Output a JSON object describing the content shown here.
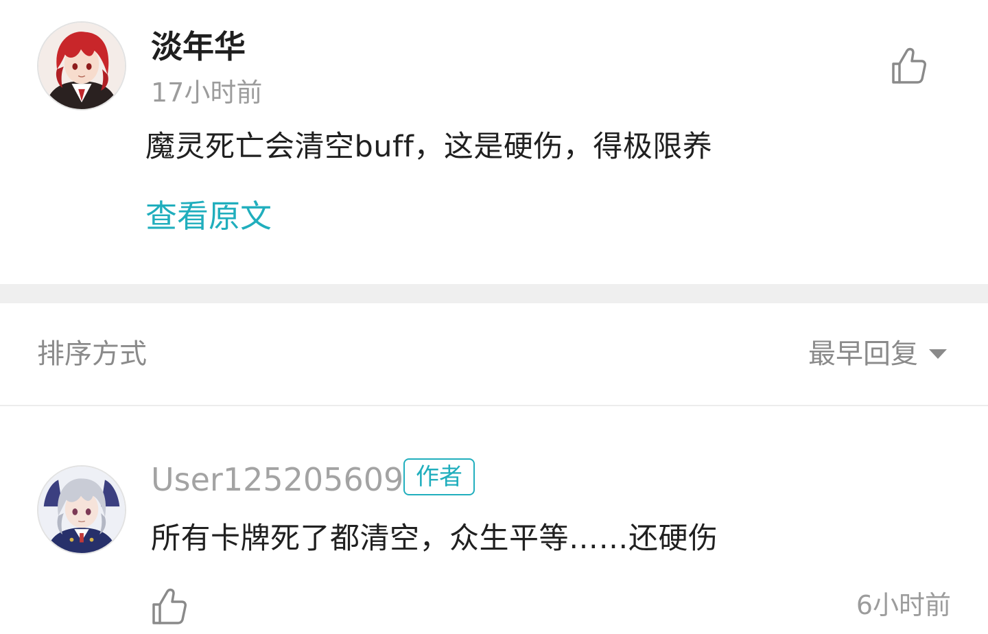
{
  "main_comment": {
    "username": "淡年华",
    "time": "17小时前",
    "content": "魔灵死亡会清空buff，这是硬伤，得极限养",
    "view_original": "查看原文",
    "avatar_icon": "avatar-red-hair-character-icon",
    "like_icon": "thumbs-up-icon"
  },
  "sort": {
    "label": "排序方式",
    "selected": "最早回复",
    "arrow_icon": "triangle-down-icon"
  },
  "reply": {
    "username": "User125205609",
    "badge": "作者",
    "content": "所有卡牌死了都清空，众生平等……还硬伤",
    "time": "6小时前",
    "avatar_icon": "avatar-silver-hair-character-icon",
    "like_icon": "thumbs-up-icon"
  },
  "colors": {
    "accent": "#20aebd",
    "primary_text": "#202020",
    "secondary_text": "#9c9c9c",
    "divider": "#efefef"
  }
}
